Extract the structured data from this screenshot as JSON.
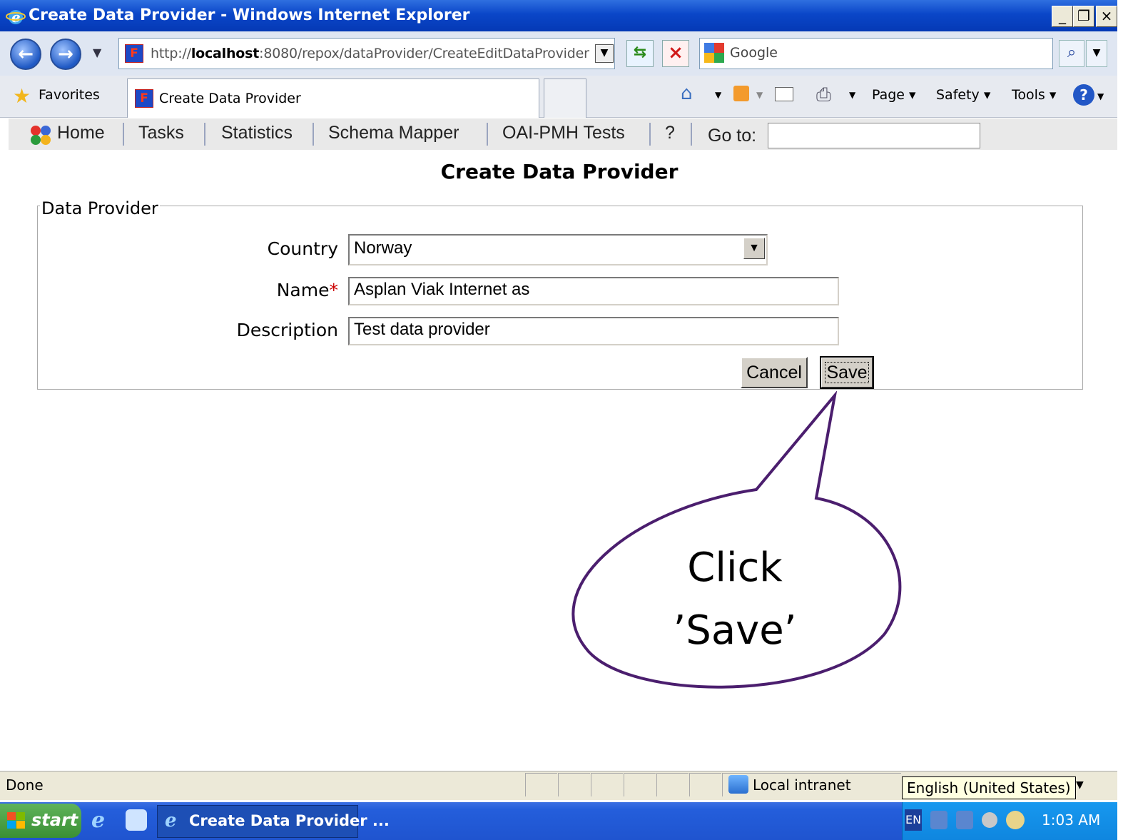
{
  "window": {
    "title": "Create Data Provider - Windows Internet Explorer",
    "minimize": "_",
    "maximize": "❐",
    "close": "×"
  },
  "address_bar": {
    "url_prefix": "http://",
    "url_host": "localhost",
    "url_path": ":8080/repox/dataProvider/CreateEditDataProvider",
    "search_placeholder": "Google"
  },
  "tabs_bar": {
    "favorites_label": "Favorites",
    "active_tab_title": "Create Data Provider",
    "commands": {
      "page": "Page",
      "safety": "Safety",
      "tools": "Tools"
    }
  },
  "app_nav": {
    "items": [
      "Home",
      "Tasks",
      "Statistics",
      "Schema Mapper",
      "OAI-PMH Tests",
      "?"
    ],
    "goto_label": "Go to:",
    "goto_value": ""
  },
  "page": {
    "title": "Create Data Provider",
    "fieldset_legend": "Data Provider",
    "fields": {
      "country_label": "Country",
      "country_value": "Norway",
      "name_label": "Name",
      "name_required_marker": "*",
      "name_value": "Asplan Viak Internet as",
      "description_label": "Description",
      "description_value": "Test data provider"
    },
    "buttons": {
      "cancel": "Cancel",
      "save": "Save"
    }
  },
  "callout": {
    "line1": "Click",
    "line2": "’Save’",
    "border_color": "#4b1e6e"
  },
  "status_bar": {
    "status": "Done",
    "zone": "Local intranet",
    "language_tooltip": "English (United States)"
  },
  "taskbar": {
    "start": "start",
    "task_item": "Create Data Provider ...",
    "language_indicator": "EN",
    "clock": "1:03 AM"
  }
}
